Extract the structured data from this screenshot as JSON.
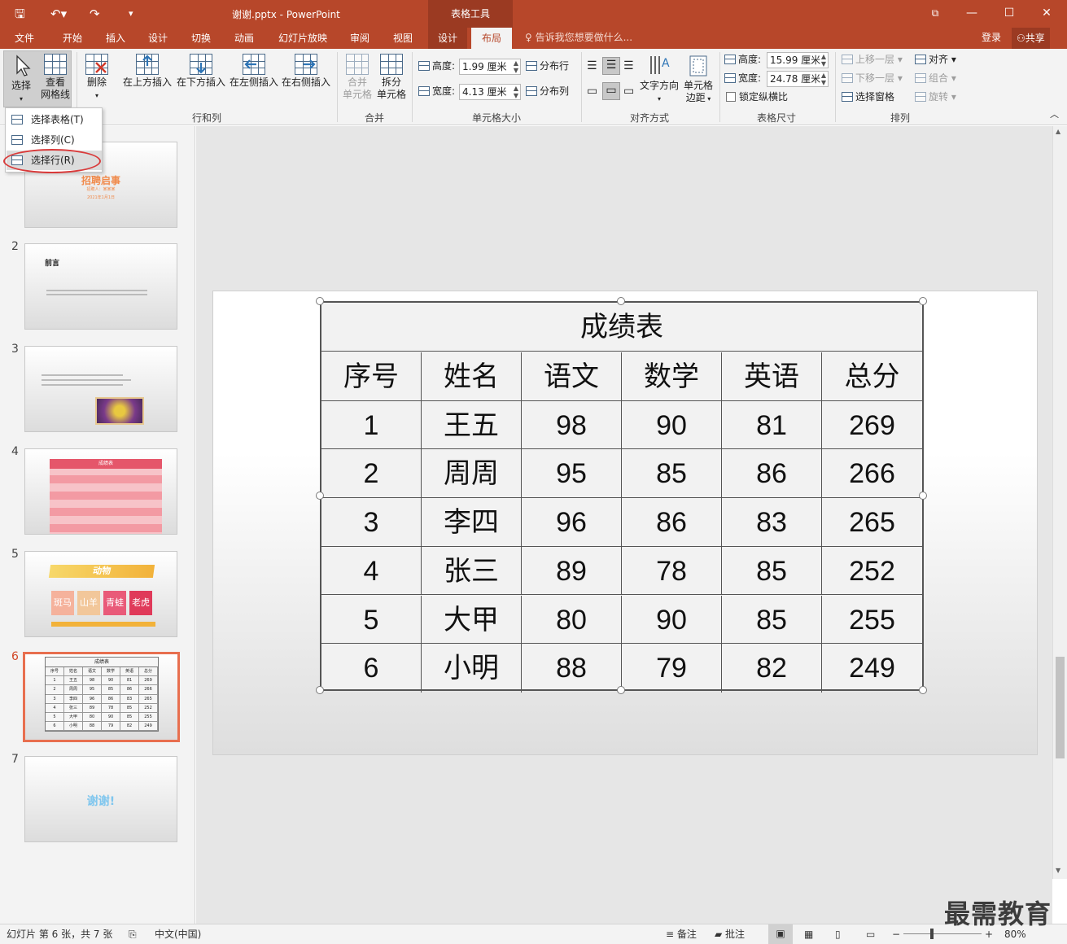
{
  "titlebar": {
    "document_title": "谢谢.pptx - PowerPoint",
    "context_tools": "表格工具",
    "minimize": "—",
    "restore": "☐",
    "close": "✕",
    "ribbon_display": "⧉"
  },
  "tabs": [
    "文件",
    "开始",
    "插入",
    "设计",
    "切换",
    "动画",
    "幻灯片放映",
    "审阅",
    "视图"
  ],
  "context_tabs": {
    "design": "设计",
    "layout": "布局"
  },
  "tell_me": "告诉我您想要做什么...",
  "account": {
    "login": "登录",
    "share": "共享"
  },
  "ribbon": {
    "select": "选择",
    "view_gridlines_1": "查看",
    "view_gridlines_2": "网格线",
    "delete": "删除",
    "insert_above": "在上方插入",
    "insert_below": "在下方插入",
    "insert_left": "在左侧插入",
    "insert_right": "在右侧插入",
    "group_rows_cols": "行和列",
    "merge_1": "合并",
    "merge_2": "单元格",
    "split_1": "拆分",
    "split_2": "单元格",
    "group_merge": "合并",
    "height_label": "高度:",
    "height_value": "1.99 厘米",
    "width_label": "宽度:",
    "width_value": "4.13 厘米",
    "distribute_rows": "分布行",
    "distribute_cols": "分布列",
    "group_cell_size": "单元格大小",
    "text_direction": "文字方向",
    "cell_margins_1": "单元格",
    "cell_margins_2": "边距",
    "group_alignment": "对齐方式",
    "table_height_label": "高度:",
    "table_height_value": "15.99 厘米",
    "table_width_label": "宽度:",
    "table_width_value": "24.78 厘米",
    "lock_ratio": "锁定纵横比",
    "group_table_size": "表格尺寸",
    "bring_forward": "上移一层",
    "send_backward": "下移一层",
    "selection_pane": "选择窗格",
    "align": "对齐",
    "group": "组合",
    "rotate": "旋转",
    "group_arrange": "排列"
  },
  "dropdown": {
    "select_table": "选择表格(T)",
    "select_column": "选择列(C)",
    "select_row": "选择行(R)"
  },
  "thumbnails": {
    "numbers": [
      "2",
      "3",
      "4",
      "5",
      "6",
      "7"
    ],
    "s1_title": "招聘启事",
    "s1_sub": "招聘人：某某某",
    "s1_date": "2021年1月1日",
    "s2_title": "前言",
    "s4_title": "成绩表",
    "s5_title": "动物",
    "s5_tiles": [
      "斑马",
      "山羊",
      "青蛙",
      "老虎"
    ],
    "s7_text": "谢谢!"
  },
  "table": {
    "title": "成绩表",
    "headers": [
      "序号",
      "姓名",
      "语文",
      "数学",
      "英语",
      "总分"
    ],
    "rows": [
      [
        "1",
        "王五",
        "98",
        "90",
        "81",
        "269"
      ],
      [
        "2",
        "周周",
        "95",
        "85",
        "86",
        "266"
      ],
      [
        "3",
        "李四",
        "96",
        "86",
        "83",
        "265"
      ],
      [
        "4",
        "张三",
        "89",
        "78",
        "85",
        "252"
      ],
      [
        "5",
        "大甲",
        "80",
        "90",
        "85",
        "255"
      ],
      [
        "6",
        "小明",
        "88",
        "79",
        "82",
        "249"
      ]
    ]
  },
  "statusbar": {
    "slide_info": "幻灯片 第 6 张，共 7 张",
    "language": "中文(中国)",
    "notes": "备注",
    "comments": "批注",
    "zoom": "80%",
    "zoom_minus": "−",
    "zoom_plus": "+"
  },
  "watermark": "最需教育"
}
